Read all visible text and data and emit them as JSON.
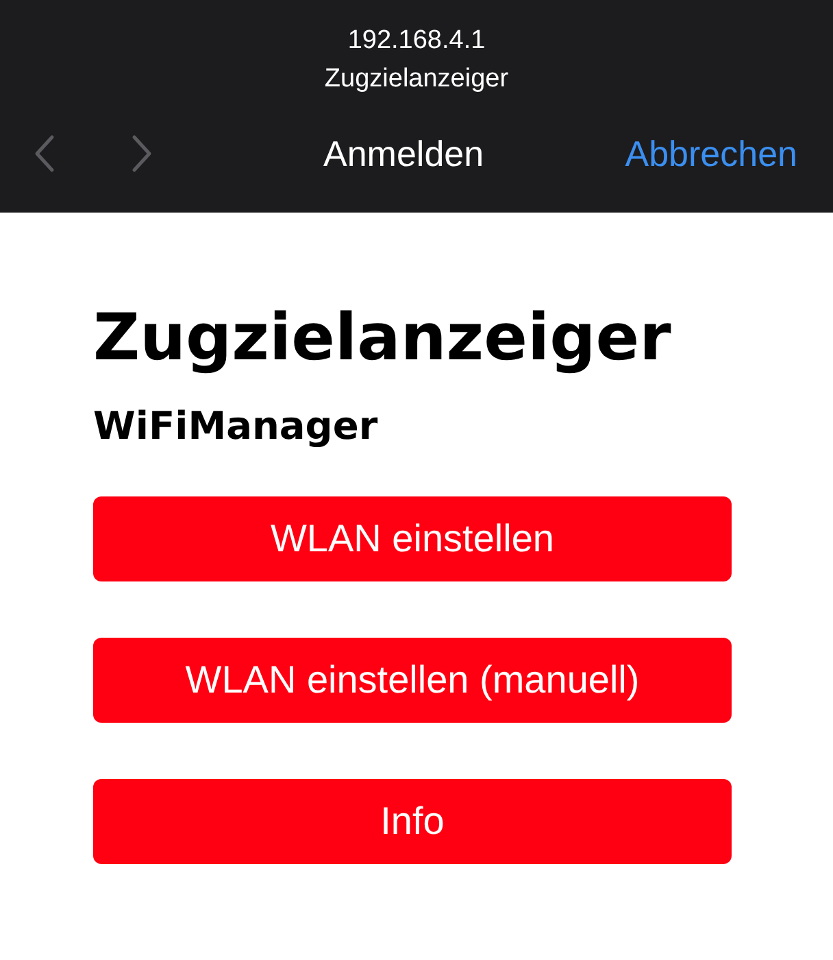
{
  "browser": {
    "address": "192.168.4.1",
    "page_title": "Zugzielanzeiger",
    "nav_buttons": [
      {
        "kind": "back",
        "disabled": true
      },
      {
        "kind": "forward",
        "disabled": true
      }
    ],
    "sheet_title": "Anmelden",
    "cancel": "Abbrechen"
  },
  "page": {
    "heading": "Zugzielanzeiger",
    "subheading": "WiFiManager",
    "buttons": [
      "WLAN einstellen",
      "WLAN einstellen (manuell)",
      "Info"
    ]
  }
}
